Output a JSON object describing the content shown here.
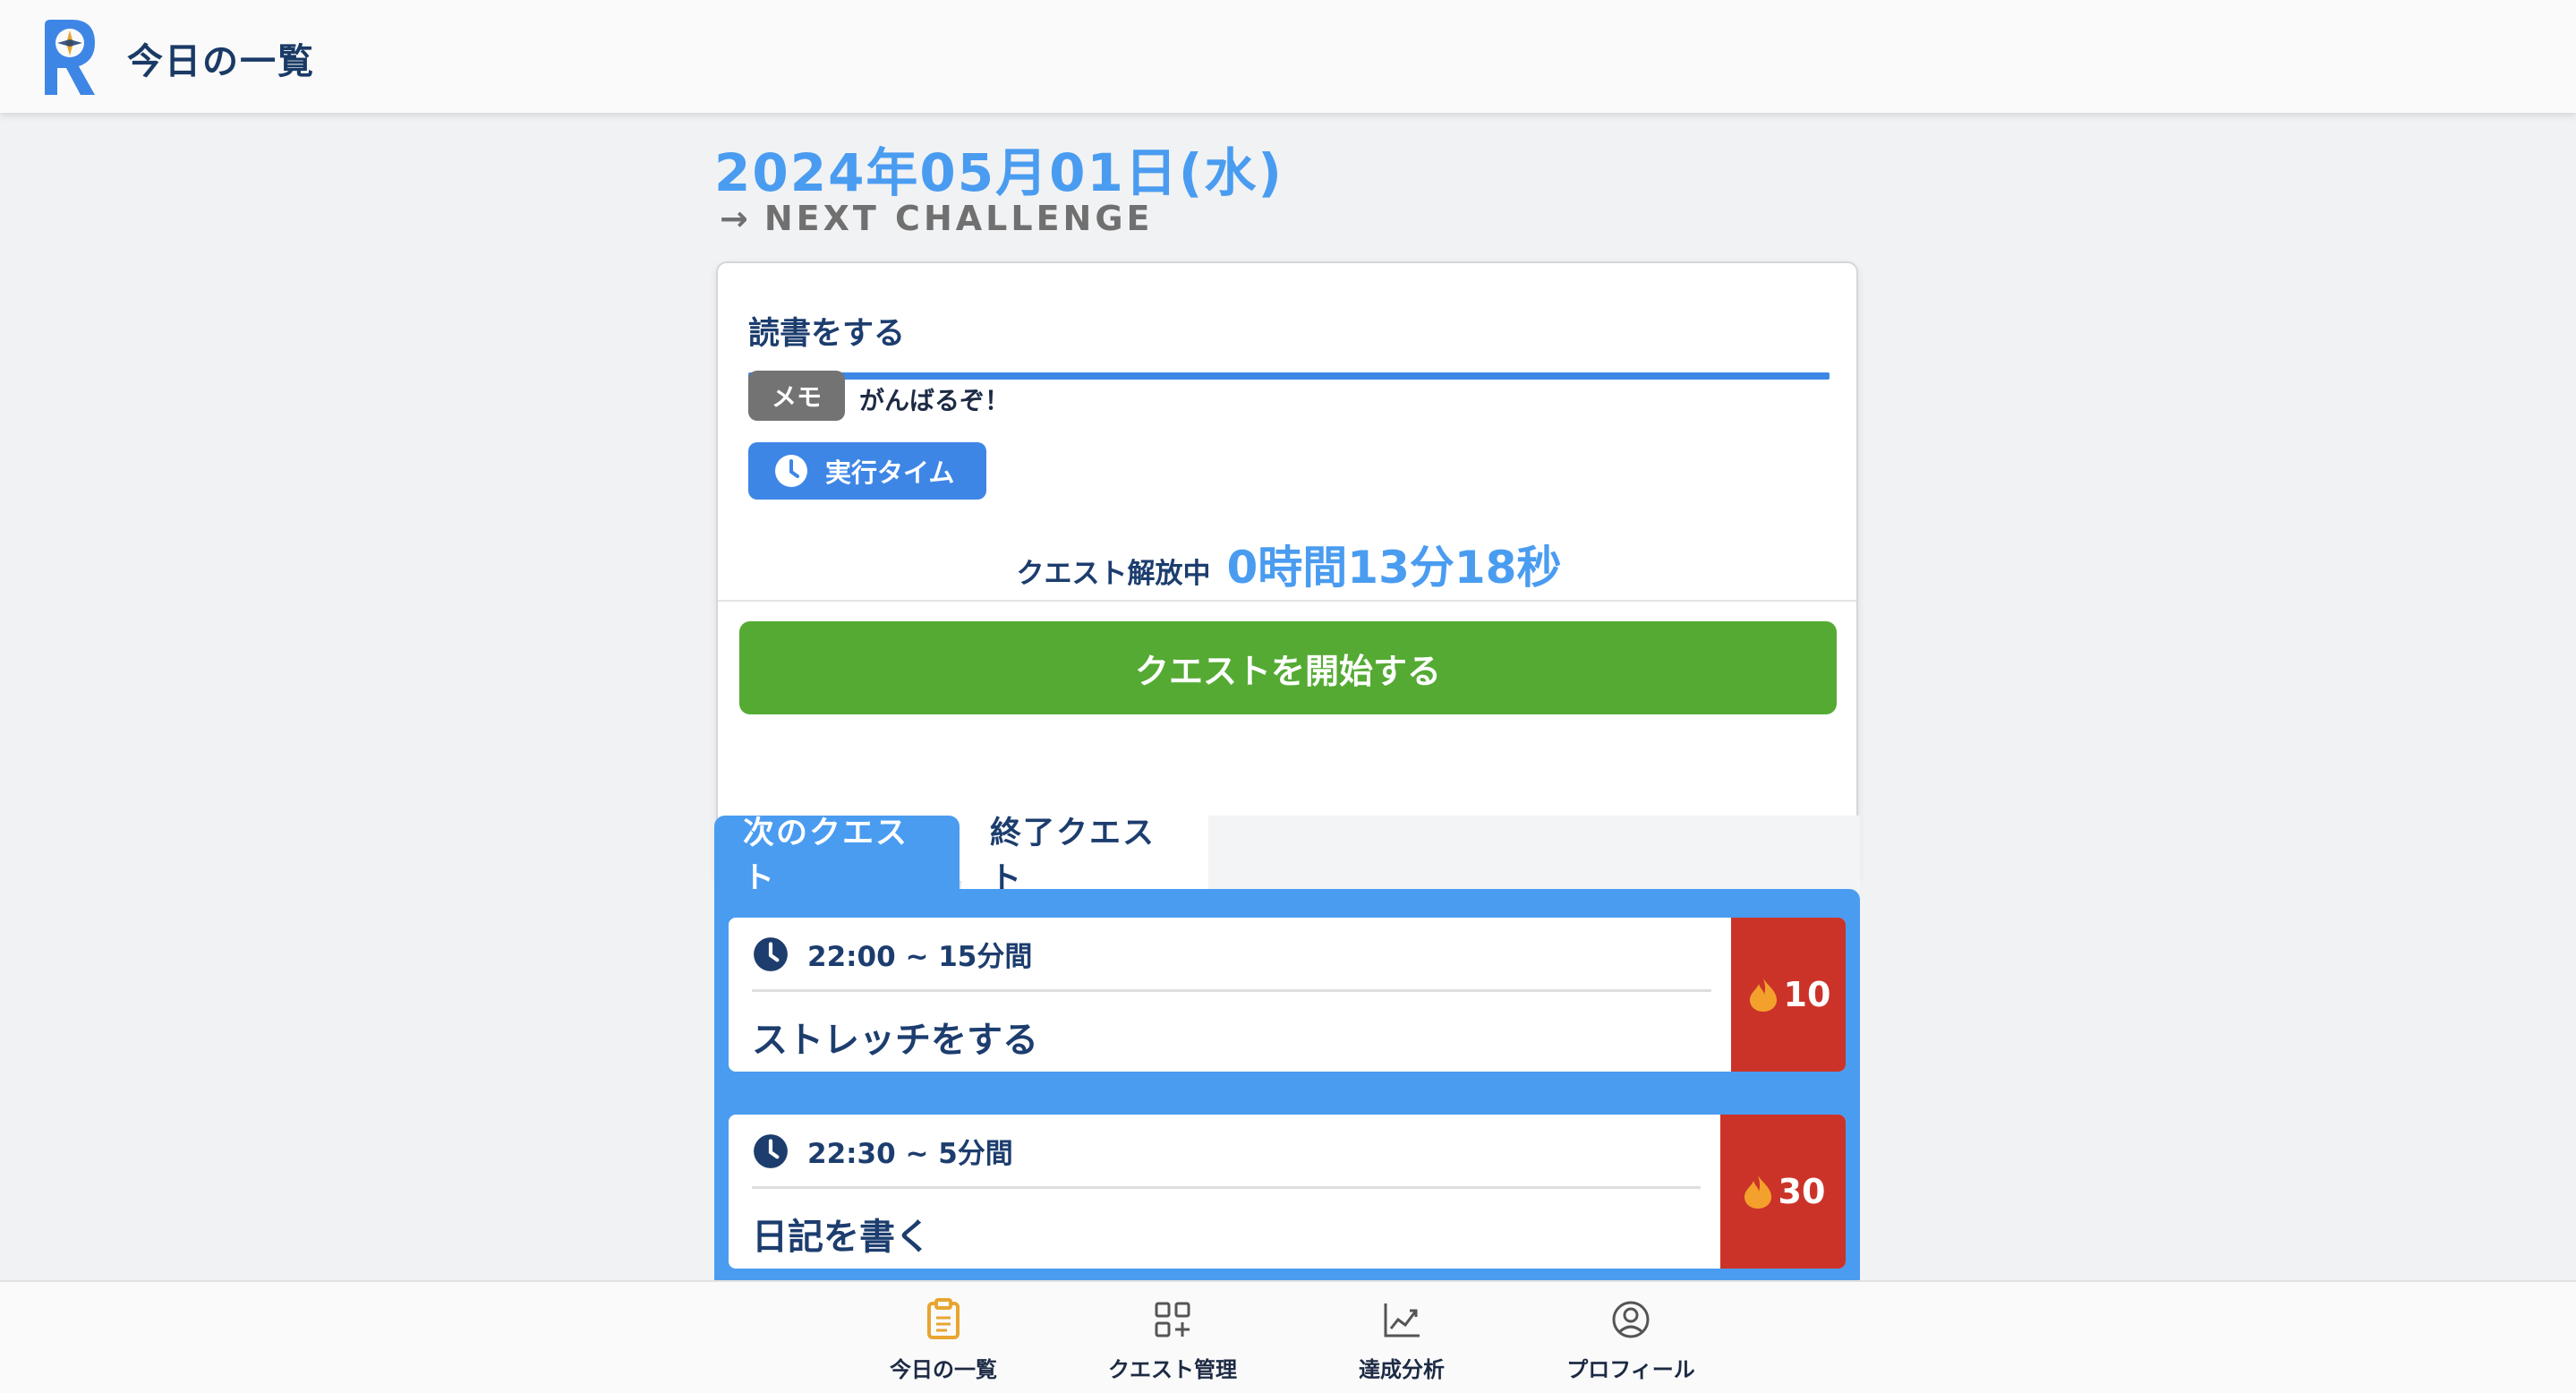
{
  "header": {
    "title": "今日の一覧",
    "logo_letter": "R"
  },
  "main": {
    "date": "2024年05月01日(水)",
    "next_challenge_arrow": "→",
    "next_challenge": "NEXT CHALLENGE"
  },
  "challenge_card": {
    "title": "読書をする",
    "memo_badge": "メモ",
    "memo_text": "がんばるぞ！",
    "exec_button": "実行タイム",
    "unlock_label": "クエスト解放中",
    "unlock_timer": "0時間13分18秒",
    "start_button": "クエストを開始する"
  },
  "tabs": [
    {
      "label": "次のクエスト",
      "active": true
    },
    {
      "label": "終了クエスト",
      "active": false
    }
  ],
  "quests": [
    {
      "time": "22:00 ~ 15分間",
      "name": "ストレッチをする",
      "points": "10"
    },
    {
      "time": "22:30 ~ 5分間",
      "name": "日記を書く",
      "points": "30"
    }
  ],
  "bottom_nav": [
    {
      "label": "今日の一覧",
      "icon": "clipboard-icon",
      "active": true
    },
    {
      "label": "クエスト管理",
      "icon": "grid-plus-icon",
      "active": false
    },
    {
      "label": "達成分析",
      "icon": "chart-line-icon",
      "active": false
    },
    {
      "label": "プロフィール",
      "icon": "user-circle-icon",
      "active": false
    }
  ],
  "colors": {
    "accent_blue": "#4a9cf0",
    "divider_blue": "#3e86e6",
    "start_green": "#55aa33",
    "points_red": "#cc3328",
    "nav_active": "#e8a531",
    "text_navy": "#1c3d6e"
  }
}
